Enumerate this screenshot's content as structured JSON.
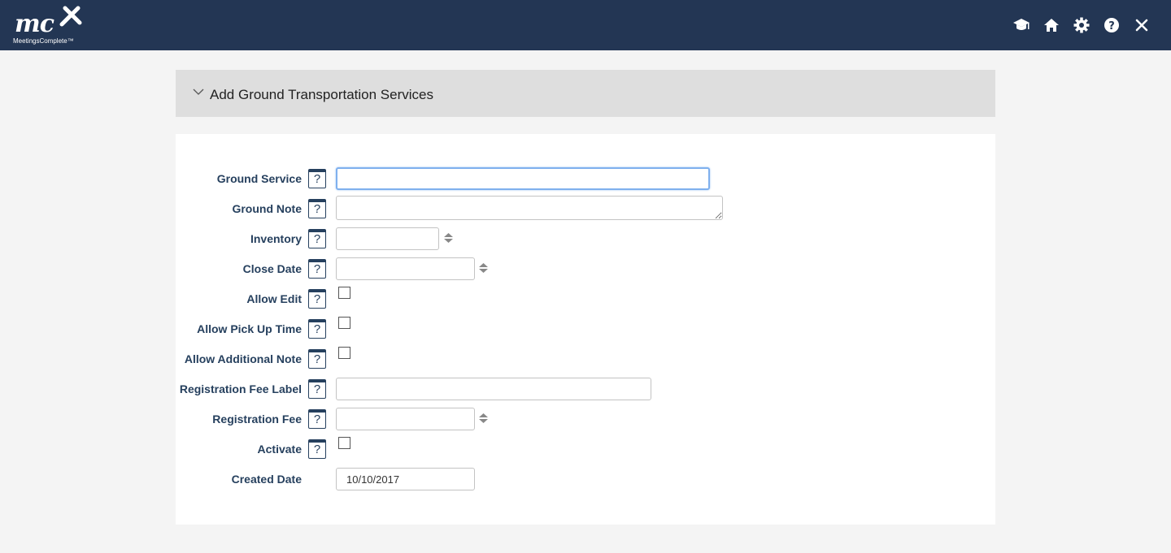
{
  "app": {
    "logo_text": "mc",
    "brand": "MeetingsComplete™"
  },
  "header_icons": [
    "graduation-cap-icon",
    "home-icon",
    "gear-icon",
    "help-circle-icon",
    "close-icon"
  ],
  "panel": {
    "title": "Add Ground Transportation Services"
  },
  "form": {
    "ground_service": {
      "label": "Ground Service",
      "value": ""
    },
    "ground_note": {
      "label": "Ground Note",
      "value": ""
    },
    "inventory": {
      "label": "Inventory",
      "value": ""
    },
    "close_date": {
      "label": "Close Date",
      "value": ""
    },
    "allow_edit": {
      "label": "Allow Edit",
      "checked": false
    },
    "allow_pick_up_time": {
      "label": "Allow Pick Up Time",
      "checked": false
    },
    "allow_additional_note": {
      "label": "Allow Additional Note",
      "checked": false
    },
    "registration_fee_label": {
      "label": "Registration Fee Label",
      "value": ""
    },
    "registration_fee": {
      "label": "Registration Fee",
      "value": ""
    },
    "activate": {
      "label": "Activate",
      "checked": false
    },
    "created_date": {
      "label": "Created Date",
      "value": "10/10/2017"
    },
    "help_glyph": "?"
  },
  "colors": {
    "topbar": "#233654",
    "label": "#26405e",
    "panel_header": "#dedede",
    "background": "#f4f4f4",
    "focus": "#7fb0ee"
  }
}
